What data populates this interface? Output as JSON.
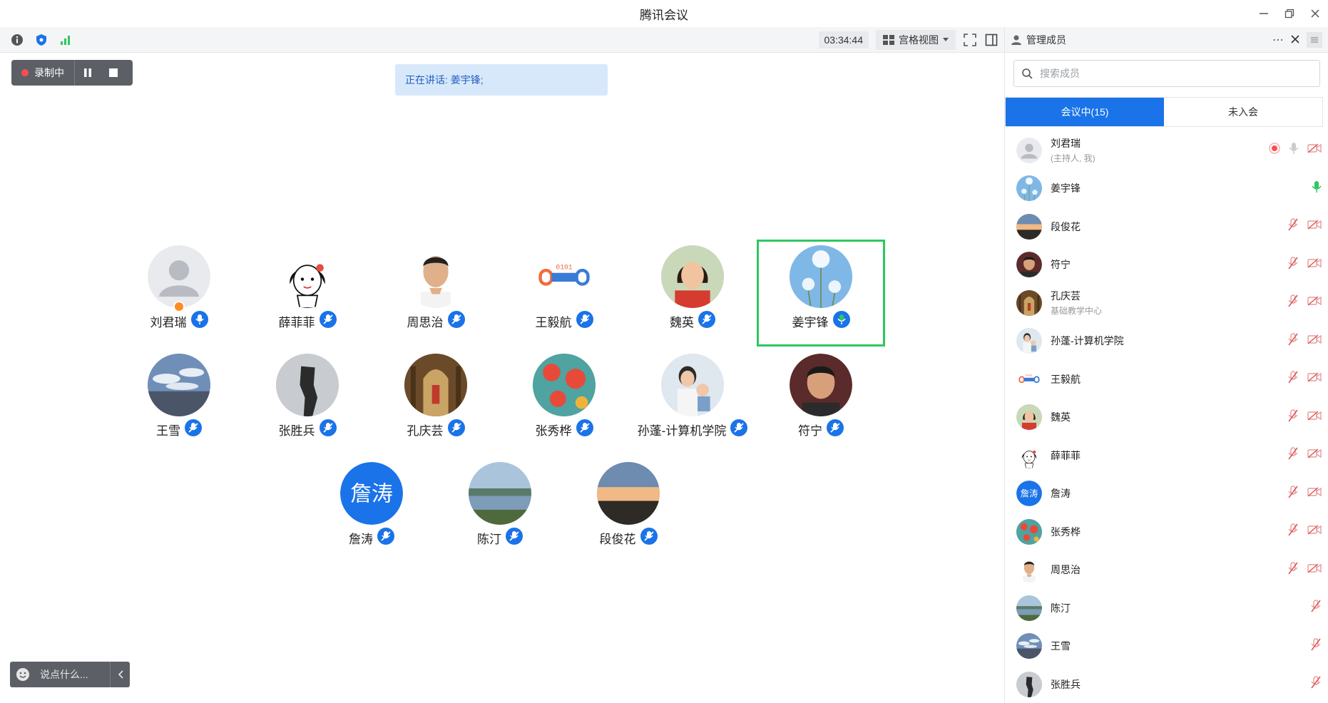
{
  "window": {
    "title": "腾讯会议"
  },
  "toolbar": {
    "timer": "03:34:44",
    "view_label": "宫格视图",
    "icons": [
      "info-icon",
      "shield-icon",
      "signal-icon",
      "fullscreen-icon",
      "sidebar-toggle-icon"
    ]
  },
  "recording": {
    "label": "录制中"
  },
  "speaking": {
    "text": "正在讲话: 姜宇锋;"
  },
  "grid": {
    "participants": [
      {
        "name": "刘君瑞",
        "avatar": "default-user",
        "mic": "on",
        "host": true
      },
      {
        "name": "薛菲菲",
        "avatar": "cartoon-girl",
        "mic": "muted"
      },
      {
        "name": "周思治",
        "avatar": "man-portrait",
        "mic": "muted"
      },
      {
        "name": "王毅航",
        "avatar": "logo-0101",
        "mic": "muted"
      },
      {
        "name": "魏英",
        "avatar": "woman-portrait",
        "mic": "muted"
      },
      {
        "name": "姜宇锋",
        "avatar": "dandelion",
        "mic": "speaking",
        "active": true
      },
      {
        "name": "王雪",
        "avatar": "sky-clouds",
        "mic": "muted"
      },
      {
        "name": "张胜兵",
        "avatar": "rock-landscape",
        "mic": "muted"
      },
      {
        "name": "孔庆芸",
        "avatar": "church-interior",
        "mic": "muted"
      },
      {
        "name": "张秀桦",
        "avatar": "red-flowers",
        "mic": "muted"
      },
      {
        "name": "孙蓬-计算机学院",
        "avatar": "mother-child",
        "mic": "muted"
      },
      {
        "name": "符宁",
        "avatar": "man-portrait-2",
        "mic": "muted"
      },
      {
        "name": "詹涛",
        "avatar": "text-avatar",
        "avatar_text": "詹涛",
        "mic": "muted"
      },
      {
        "name": "陈汀",
        "avatar": "lake-landscape",
        "mic": "muted"
      },
      {
        "name": "段俊花",
        "avatar": "sunset",
        "mic": "muted"
      }
    ]
  },
  "chat": {
    "placeholder": "说点什么..."
  },
  "panel": {
    "title": "管理成员",
    "search_placeholder": "搜索成员",
    "tabs": [
      "会议中(15)",
      "未入会"
    ],
    "members": [
      {
        "name": "刘君瑞",
        "sub": "(主持人, 我)",
        "avatar": "default-user",
        "rec": true,
        "mic": "off-gray",
        "cam": "off"
      },
      {
        "name": "姜宇锋",
        "sub": "",
        "avatar": "dandelion",
        "mic": "speaking"
      },
      {
        "name": "段俊花",
        "sub": "",
        "avatar": "sunset",
        "mic": "muted",
        "cam": "off"
      },
      {
        "name": "符宁",
        "sub": "",
        "avatar": "man-portrait-2",
        "mic": "muted",
        "cam": "off"
      },
      {
        "name": "孔庆芸",
        "sub": "基础教学中心",
        "avatar": "church-interior",
        "mic": "muted",
        "cam": "off"
      },
      {
        "name": "孙蓬-计算机学院",
        "sub": "",
        "avatar": "mother-child",
        "mic": "muted",
        "cam": "off"
      },
      {
        "name": "王毅航",
        "sub": "",
        "avatar": "logo-0101",
        "mic": "muted",
        "cam": "off"
      },
      {
        "name": "魏英",
        "sub": "",
        "avatar": "woman-portrait",
        "mic": "muted",
        "cam": "off"
      },
      {
        "name": "薛菲菲",
        "sub": "",
        "avatar": "cartoon-girl",
        "mic": "muted",
        "cam": "off"
      },
      {
        "name": "詹涛",
        "sub": "",
        "avatar": "text-avatar",
        "avatar_text": "詹涛",
        "mic": "muted",
        "cam": "off"
      },
      {
        "name": "张秀桦",
        "sub": "",
        "avatar": "red-flowers",
        "mic": "muted",
        "cam": "off"
      },
      {
        "name": "周思治",
        "sub": "",
        "avatar": "man-portrait",
        "mic": "muted",
        "cam": "off"
      },
      {
        "name": "陈汀",
        "sub": "",
        "avatar": "lake-landscape",
        "mic": "muted"
      },
      {
        "name": "王雪",
        "sub": "",
        "avatar": "sky-clouds",
        "mic": "muted"
      },
      {
        "name": "张胜兵",
        "sub": "",
        "avatar": "rock-landscape",
        "mic": "muted"
      }
    ]
  },
  "colors": {
    "accent": "#1a73e8",
    "speaking": "#2ec760",
    "record": "#ff4d4f",
    "host": "#ff8a1f"
  }
}
